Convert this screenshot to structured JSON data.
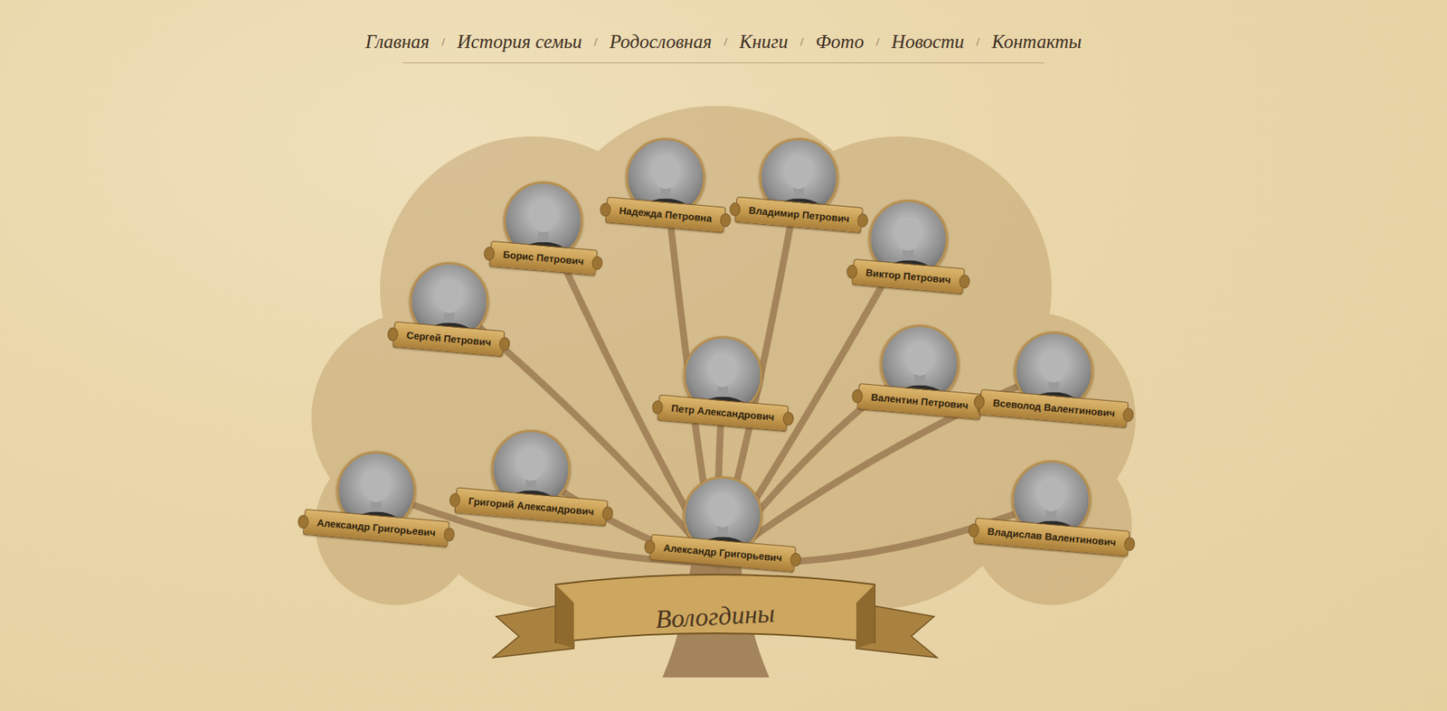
{
  "nav": {
    "items": [
      {
        "label": "Главная"
      },
      {
        "label": "История семьи"
      },
      {
        "label": "Родословная"
      },
      {
        "label": "Книги"
      },
      {
        "label": "Фото"
      },
      {
        "label": "Новости"
      },
      {
        "label": "Контакты"
      }
    ],
    "separator": "/"
  },
  "tree": {
    "title": "Вологдины",
    "people": [
      {
        "name": "Надежда Петровна"
      },
      {
        "name": "Владимир Петрович"
      },
      {
        "name": "Борис Петрович"
      },
      {
        "name": "Виктор Петрович"
      },
      {
        "name": "Сергей Петрович"
      },
      {
        "name": "Петр Александрович"
      },
      {
        "name": "Валентин Петрович"
      },
      {
        "name": "Всеволод Валентинович"
      },
      {
        "name": "Александр Григорьевич"
      },
      {
        "name": "Григорий Александрович"
      },
      {
        "name": "Александр Григорьевич"
      },
      {
        "name": "Владислав Валентинович"
      }
    ]
  }
}
